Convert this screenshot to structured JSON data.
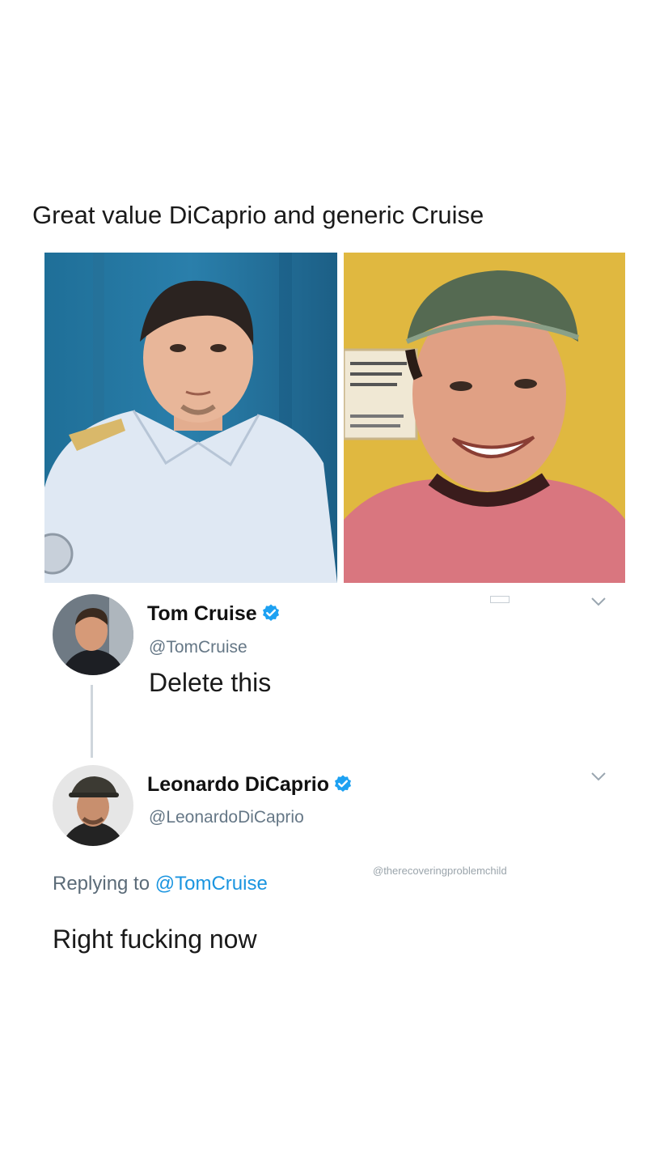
{
  "meme": {
    "caption": "Great value DiCaprio and generic Cruise"
  },
  "photos": {
    "left_alt": "Great value DiCaprio",
    "right_alt": "generic Cruise"
  },
  "tweet1": {
    "display_name": "Tom Cruise",
    "handle": "@TomCruise",
    "text": "Delete this",
    "verified": true
  },
  "tweet2": {
    "display_name": "Leonardo DiCaprio",
    "handle": "@LeonardoDiCaprio",
    "replying_prefix": "Replying to",
    "replying_to": "@TomCruise",
    "text": "Right fucking now",
    "verified": true
  },
  "watermark": "@therecoveringproblemchild",
  "colors": {
    "verified_blue": "#1da1f2",
    "link_blue": "#1b95e0",
    "handle_gray": "#657786"
  },
  "icons": {
    "verified": "verified-badge-icon",
    "dropdown": "chevron-down-icon"
  }
}
